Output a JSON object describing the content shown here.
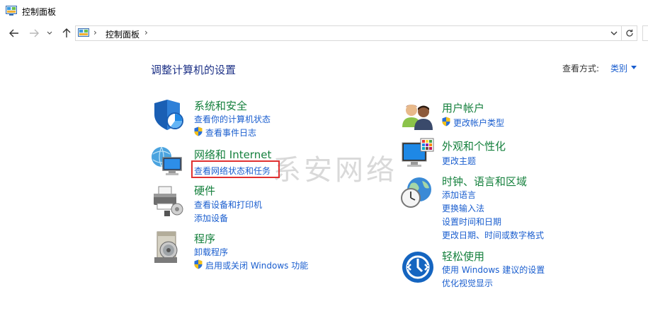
{
  "window": {
    "title": "控制面板"
  },
  "navbar": {
    "breadcrumb": "控制面板",
    "separator": "›"
  },
  "main": {
    "heading": "调整计算机的设置",
    "view_by_label": "查看方式:",
    "view_by_value": "类别"
  },
  "watermark": "系安网络",
  "categories": [
    {
      "title": "系统和安全",
      "links": [
        "查看你的计算机状态",
        "查看事件日志"
      ],
      "icon": "shield-icon"
    },
    {
      "title": "网络和 Internet",
      "links": [
        "查看网络状态和任务"
      ],
      "icon": "network-icon"
    },
    {
      "title": "硬件",
      "links": [
        "查看设备和打印机",
        "添加设备"
      ],
      "icon": "printer-icon"
    },
    {
      "title": "程序",
      "links": [
        "卸载程序",
        "启用或关闭 Windows 功能"
      ],
      "icon": "programs-icon"
    },
    {
      "title": "用户帐户",
      "links": [
        "更改帐户类型"
      ],
      "icon": "users-icon"
    },
    {
      "title": "外观和个性化",
      "links": [
        "更改主题"
      ],
      "icon": "appearance-icon"
    },
    {
      "title": "时钟、语言和区域",
      "links": [
        "添加语言",
        "更换输入法",
        "设置时间和日期",
        "更改日期、时间或数字格式"
      ],
      "icon": "clock-globe-icon"
    },
    {
      "title": "轻松使用",
      "links": [
        "使用 Windows 建议的设置",
        "优化视觉显示"
      ],
      "icon": "ease-of-access-icon"
    }
  ],
  "colors": {
    "category_title": "#15803d",
    "link": "#1a5ecf",
    "heading": "#1e3287",
    "highlight": "#e03030"
  }
}
